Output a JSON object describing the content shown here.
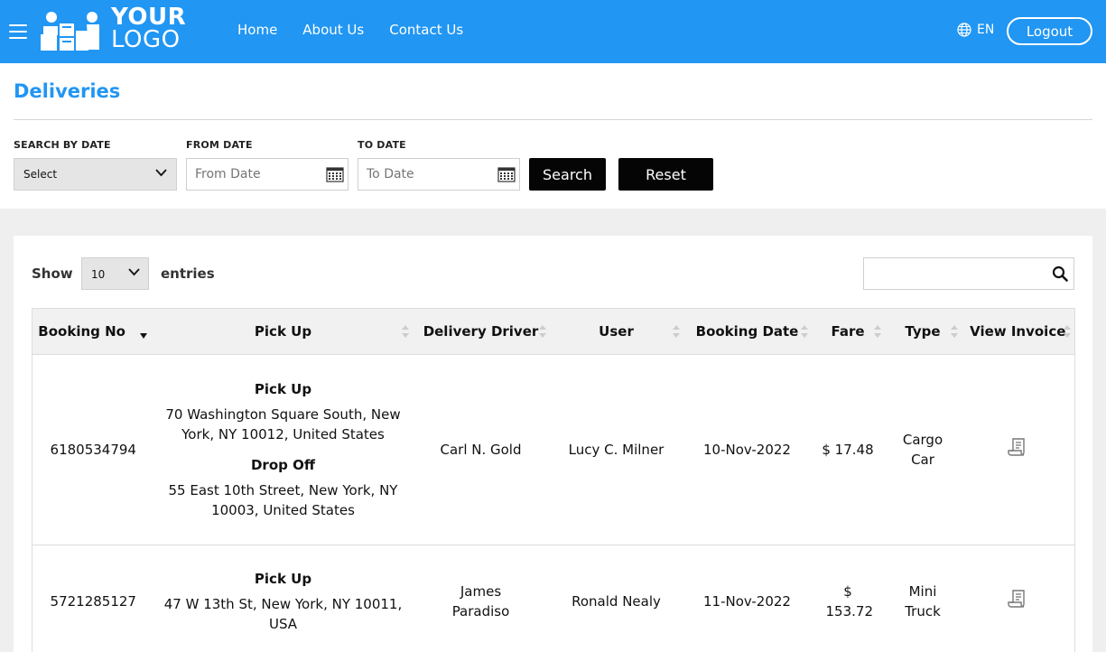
{
  "header": {
    "logo_line1": "YOUR",
    "logo_line2": "LOGO",
    "nav": [
      {
        "label": "Home"
      },
      {
        "label": "About Us"
      },
      {
        "label": "Contact Us"
      }
    ],
    "language": "EN",
    "logout_label": "Logout",
    "accent_color": "#2196f3"
  },
  "filters": {
    "title": "Deliveries",
    "search_by_date_label": "SEARCH BY DATE",
    "search_by_date_value": "Select",
    "from_date_label": "FROM DATE",
    "from_date_placeholder": "From Date",
    "to_date_label": "TO DATE",
    "to_date_placeholder": "To Date",
    "search_button": "Search",
    "reset_button": "Reset"
  },
  "table": {
    "show_label": "Show",
    "page_length": "10",
    "entries_label": "entries",
    "search_value": "",
    "columns": [
      "Booking No",
      "Pick Up",
      "Delivery Driver",
      "User",
      "Booking Date",
      "Fare",
      "Type",
      "View Invoice"
    ],
    "rows": [
      {
        "booking_no": "6180534794",
        "pickup_heading": "Pick Up",
        "pickup_address": "70 Washington Square South, New York, NY 10012, United States",
        "dropoff_heading": "Drop Off",
        "dropoff_address": "55 East 10th Street, New York, NY 10003, United States",
        "driver": "Carl N. Gold",
        "user": "Lucy C. Milner",
        "booking_date": "10-Nov-2022",
        "fare": "$ 17.48",
        "type": "Cargo Car",
        "invoice_icon": "invoice-icon"
      },
      {
        "booking_no": "5721285127",
        "pickup_heading": "Pick Up",
        "pickup_address": "47 W 13th St, New York, NY 10011, USA",
        "driver": "James Paradiso",
        "user": "Ronald Nealy",
        "booking_date": "11-Nov-2022",
        "fare": "$ 153.72",
        "type": "Mini Truck",
        "invoice_icon": "invoice-icon"
      }
    ]
  }
}
